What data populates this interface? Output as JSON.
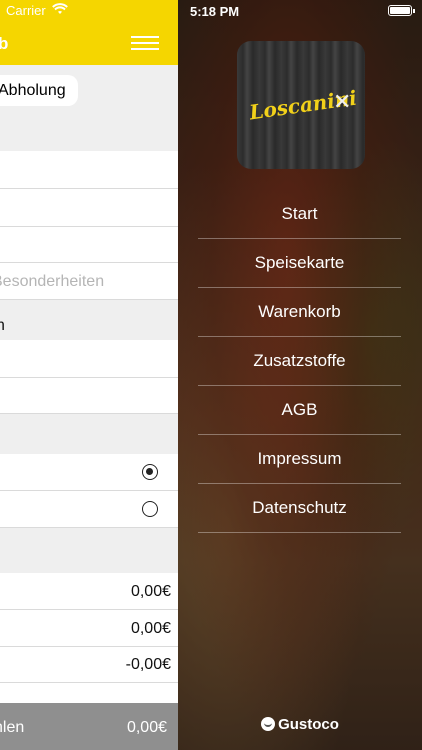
{
  "status_left": {
    "carrier": "Carrier"
  },
  "status_right": {
    "time": "5:18 PM"
  },
  "navbar": {
    "title": "b"
  },
  "pickup": {
    "label": "Abholung"
  },
  "form": {
    "remarks_placeholder": "Besonderheiten",
    "section_row_text": "n"
  },
  "prices": {
    "row1": "0,00€",
    "row2": "0,00€",
    "row3": "-0,00€"
  },
  "bottom": {
    "label": "hlen",
    "total": "0,00€"
  },
  "logo": {
    "wordmark": "Loscanini"
  },
  "menu": {
    "items": [
      {
        "label": "Start"
      },
      {
        "label": "Speisekarte"
      },
      {
        "label": "Warenkorb"
      },
      {
        "label": "Zusatzstoffe"
      },
      {
        "label": "AGB"
      },
      {
        "label": "Impressum"
      },
      {
        "label": "Datenschutz"
      }
    ]
  },
  "brand": {
    "name": "Gustoco"
  },
  "colors": {
    "accent": "#f5d600",
    "bottom_bar": "#8f8f8f"
  }
}
